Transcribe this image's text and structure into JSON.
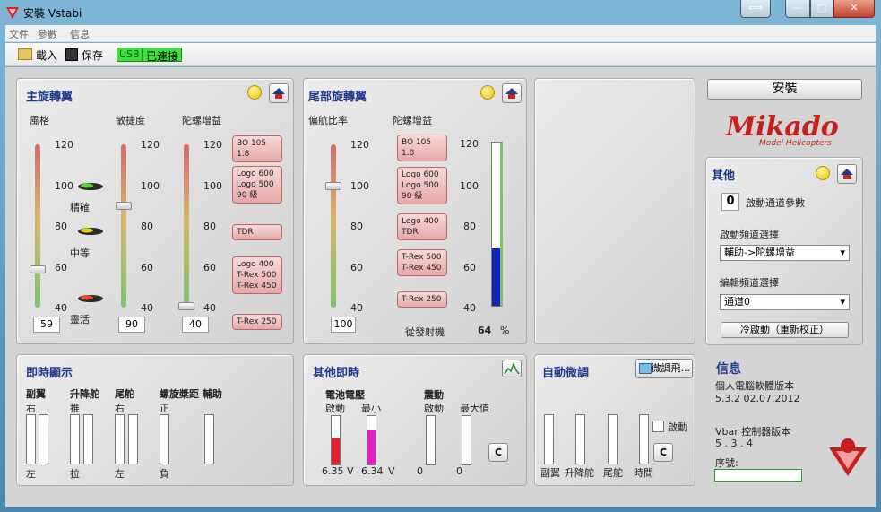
{
  "window": {
    "title": "安裝 Vstabi"
  },
  "menu": [
    "文件",
    "參數",
    "信息"
  ],
  "toolbar": {
    "load": "載入",
    "save": "保存",
    "usb": "USB",
    "connected": "已連接"
  },
  "main_rotor": {
    "title": "主旋轉翼",
    "col_style": "風格",
    "col_agility": "敏捷度",
    "col_gyro": "陀螺增益",
    "ticks": [
      "120",
      "100",
      "80",
      "60",
      "40"
    ],
    "modes": [
      "精確",
      "中等",
      "靈活"
    ],
    "values": {
      "style": "59",
      "agility": "90",
      "gyro": "40"
    },
    "tips": [
      "BO 105 1.8",
      "Logo 600\nLogo 500\n90 級",
      "TDR",
      "Logo 400\nT-Rex 500\nT-Rex 450",
      "T-Rex 250"
    ]
  },
  "tail_rotor": {
    "title": "尾部旋轉翼",
    "col_yaw": "偏航比率",
    "col_gyro": "陀螺增益",
    "ticks": [
      "120",
      "100",
      "80",
      "60",
      "40"
    ],
    "value": "100",
    "tips": [
      "BO 105 1.8",
      "Logo 600\nLogo 500\n90 級",
      "Logo 400\nTDR",
      "T-Rex 500\nT-Rex 450",
      "T-Rex 250"
    ],
    "transmitter_label": "從發射機",
    "transmitter_value": "64",
    "percent": "%",
    "gauge_fraction": 0.35
  },
  "install": {
    "button": "安裝",
    "logo": "Mikado",
    "logo_sub": "Model Helicopters"
  },
  "other": {
    "title": "其他",
    "count": "0",
    "count_label": "啟動通道參數",
    "start_channel_label": "啟動頻道選擇",
    "start_channel_value": "輔助->陀螺增益",
    "edit_channel_label": "編輯頻道選擇",
    "edit_channel_value": "通道0",
    "cold_start": "冷啟動（重新校正）"
  },
  "realtime": {
    "title": "即時顯示",
    "cols": [
      "副翼",
      "升降舵",
      "尾舵",
      "螺旋槳距 輔助"
    ],
    "top": [
      "右",
      "推",
      "右",
      "正"
    ],
    "bottom": [
      "左",
      "拉",
      "左",
      "負"
    ]
  },
  "other_realtime": {
    "title": "其他即時",
    "voltage": "電池電壓",
    "vibration": "震動",
    "start": "啟動",
    "min": "最小",
    "start2": "啟動",
    "max": "最大值",
    "v1": "6.35",
    "v2": "6.34",
    "unit": "V",
    "n1": "0",
    "n2": "0",
    "clear": "C",
    "v1_fraction": 0.55,
    "v2_fraction": 0.7
  },
  "autotune": {
    "title": "自動微調",
    "finetune": "微調飛...",
    "enable": "啟動",
    "clear": "C",
    "labels": [
      "副翼",
      "升降舵",
      "尾舵",
      "時間"
    ]
  },
  "info": {
    "title": "信息",
    "pc_label": "個人電腦軟體版本",
    "pc_version": "5.3.2  02.07.2012",
    "vbar_label": "Vbar 控制器版本",
    "vbar_version": "5 . 3 . 4",
    "serial_label": "序號:"
  },
  "colors": {
    "accent": "#1f3a8a",
    "usb": "#3ee03e",
    "battery": "#e0202a",
    "battery2": "#e020c0",
    "gauge": "#1424b8"
  }
}
